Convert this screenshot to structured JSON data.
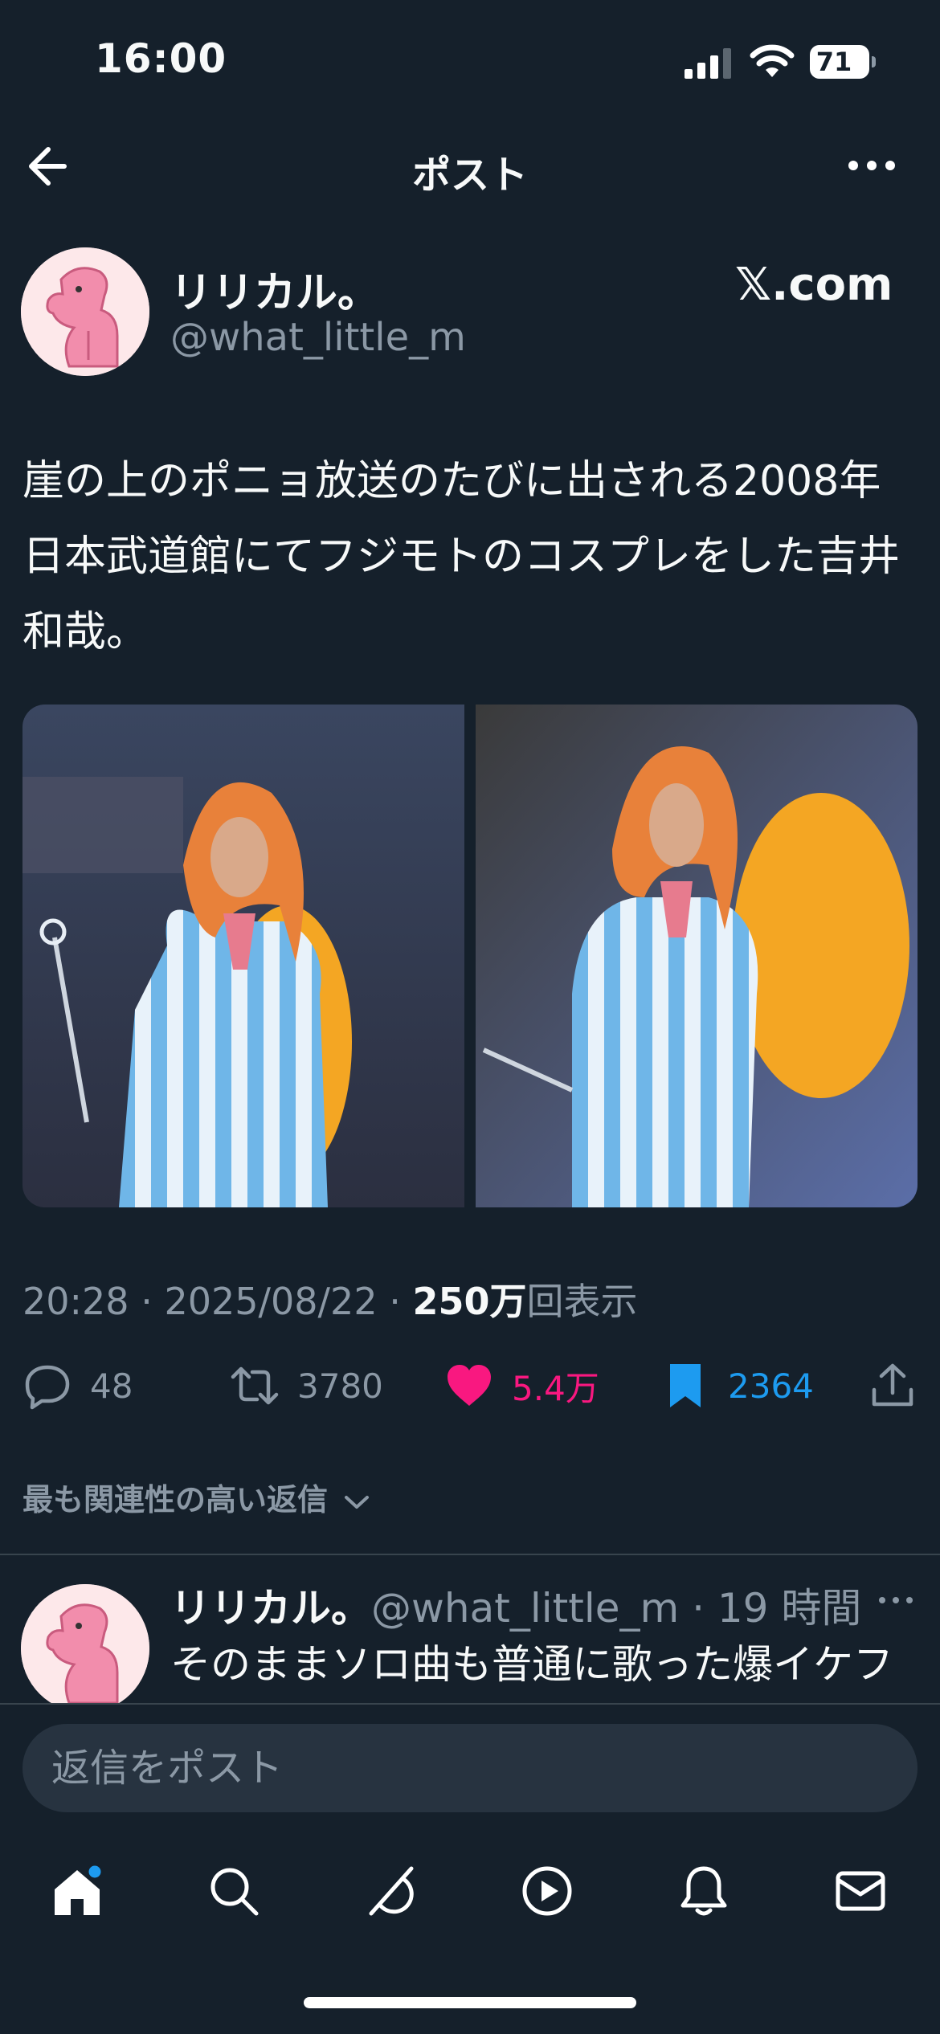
{
  "status_bar": {
    "time": "16:00",
    "battery": "71"
  },
  "header": {
    "title": "ポスト"
  },
  "post": {
    "author_name": "リリカル。",
    "author_handle": "@what_little_m",
    "source": "𝕏.com",
    "text": "崖の上のポニョ放送のたびに出される2008年日本武道館にてフジモトのコスプレをした吉井和哉。",
    "time": "20:28",
    "date": "2025/08/22",
    "views_count": "250万",
    "views_label": "回表示"
  },
  "actions": {
    "replies": "48",
    "reposts": "3780",
    "likes": "5.4万",
    "bookmarks": "2364"
  },
  "sort_label": "最も関連性の高い返信",
  "reply": {
    "author_name": "リリカル。",
    "author_handle": "@what_little_m",
    "time": "19 時間",
    "text": "そのままソロ曲も普通に歌った爆イケフジモト"
  },
  "composer": {
    "placeholder": "返信をポスト"
  },
  "colors": {
    "background": "#15202b",
    "like": "#f91880",
    "bookmark": "#1d9bf0",
    "muted": "#8b98a5"
  }
}
